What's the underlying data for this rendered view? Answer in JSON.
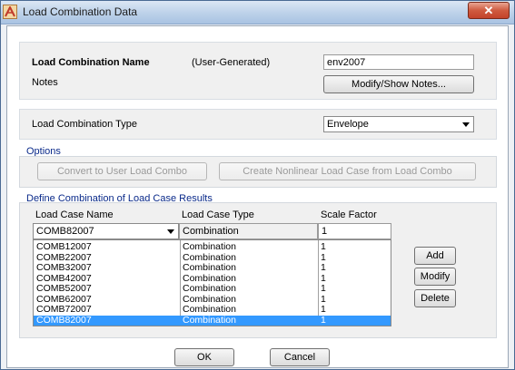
{
  "window": {
    "title": "Load Combination Data",
    "close_glyph": "✕"
  },
  "combo_name": {
    "label": "Load Combination Name",
    "source": "(User-Generated)",
    "value": "env2007"
  },
  "notes": {
    "label": "Notes",
    "button": "Modify/Show Notes..."
  },
  "combo_type": {
    "label": "Load Combination Type",
    "value": "Envelope"
  },
  "options": {
    "title": "Options",
    "convert_button": "Convert to User Load Combo",
    "create_button": "Create Nonlinear Load Case from Load Combo"
  },
  "define": {
    "title": "Define Combination of Load Case Results",
    "headers": {
      "case_name": "Load Case Name",
      "case_type": "Load Case Type",
      "scale_factor": "Scale Factor"
    },
    "edit_row": {
      "case_name": "COMB82007",
      "case_type": "Combination",
      "scale_factor": "1"
    },
    "rows": [
      {
        "name": "COMB12007",
        "type": "Combination",
        "scale": "1"
      },
      {
        "name": "COMB22007",
        "type": "Combination",
        "scale": "1"
      },
      {
        "name": "COMB32007",
        "type": "Combination",
        "scale": "1"
      },
      {
        "name": "COMB42007",
        "type": "Combination",
        "scale": "1"
      },
      {
        "name": "COMB52007",
        "type": "Combination",
        "scale": "1"
      },
      {
        "name": "COMB62007",
        "type": "Combination",
        "scale": "1"
      },
      {
        "name": "COMB72007",
        "type": "Combination",
        "scale": "1"
      },
      {
        "name": "COMB82007",
        "type": "Combination",
        "scale": "1",
        "selected": true
      }
    ],
    "add_button": "Add",
    "modify_button": "Modify",
    "delete_button": "Delete"
  },
  "footer": {
    "ok_button": "OK",
    "cancel_button": "Cancel"
  },
  "colors": {
    "selection": "#3399ff",
    "group_title": "#0a2a8a",
    "title_bar": "#bcd1e9",
    "close_button": "#cf5a3f"
  }
}
